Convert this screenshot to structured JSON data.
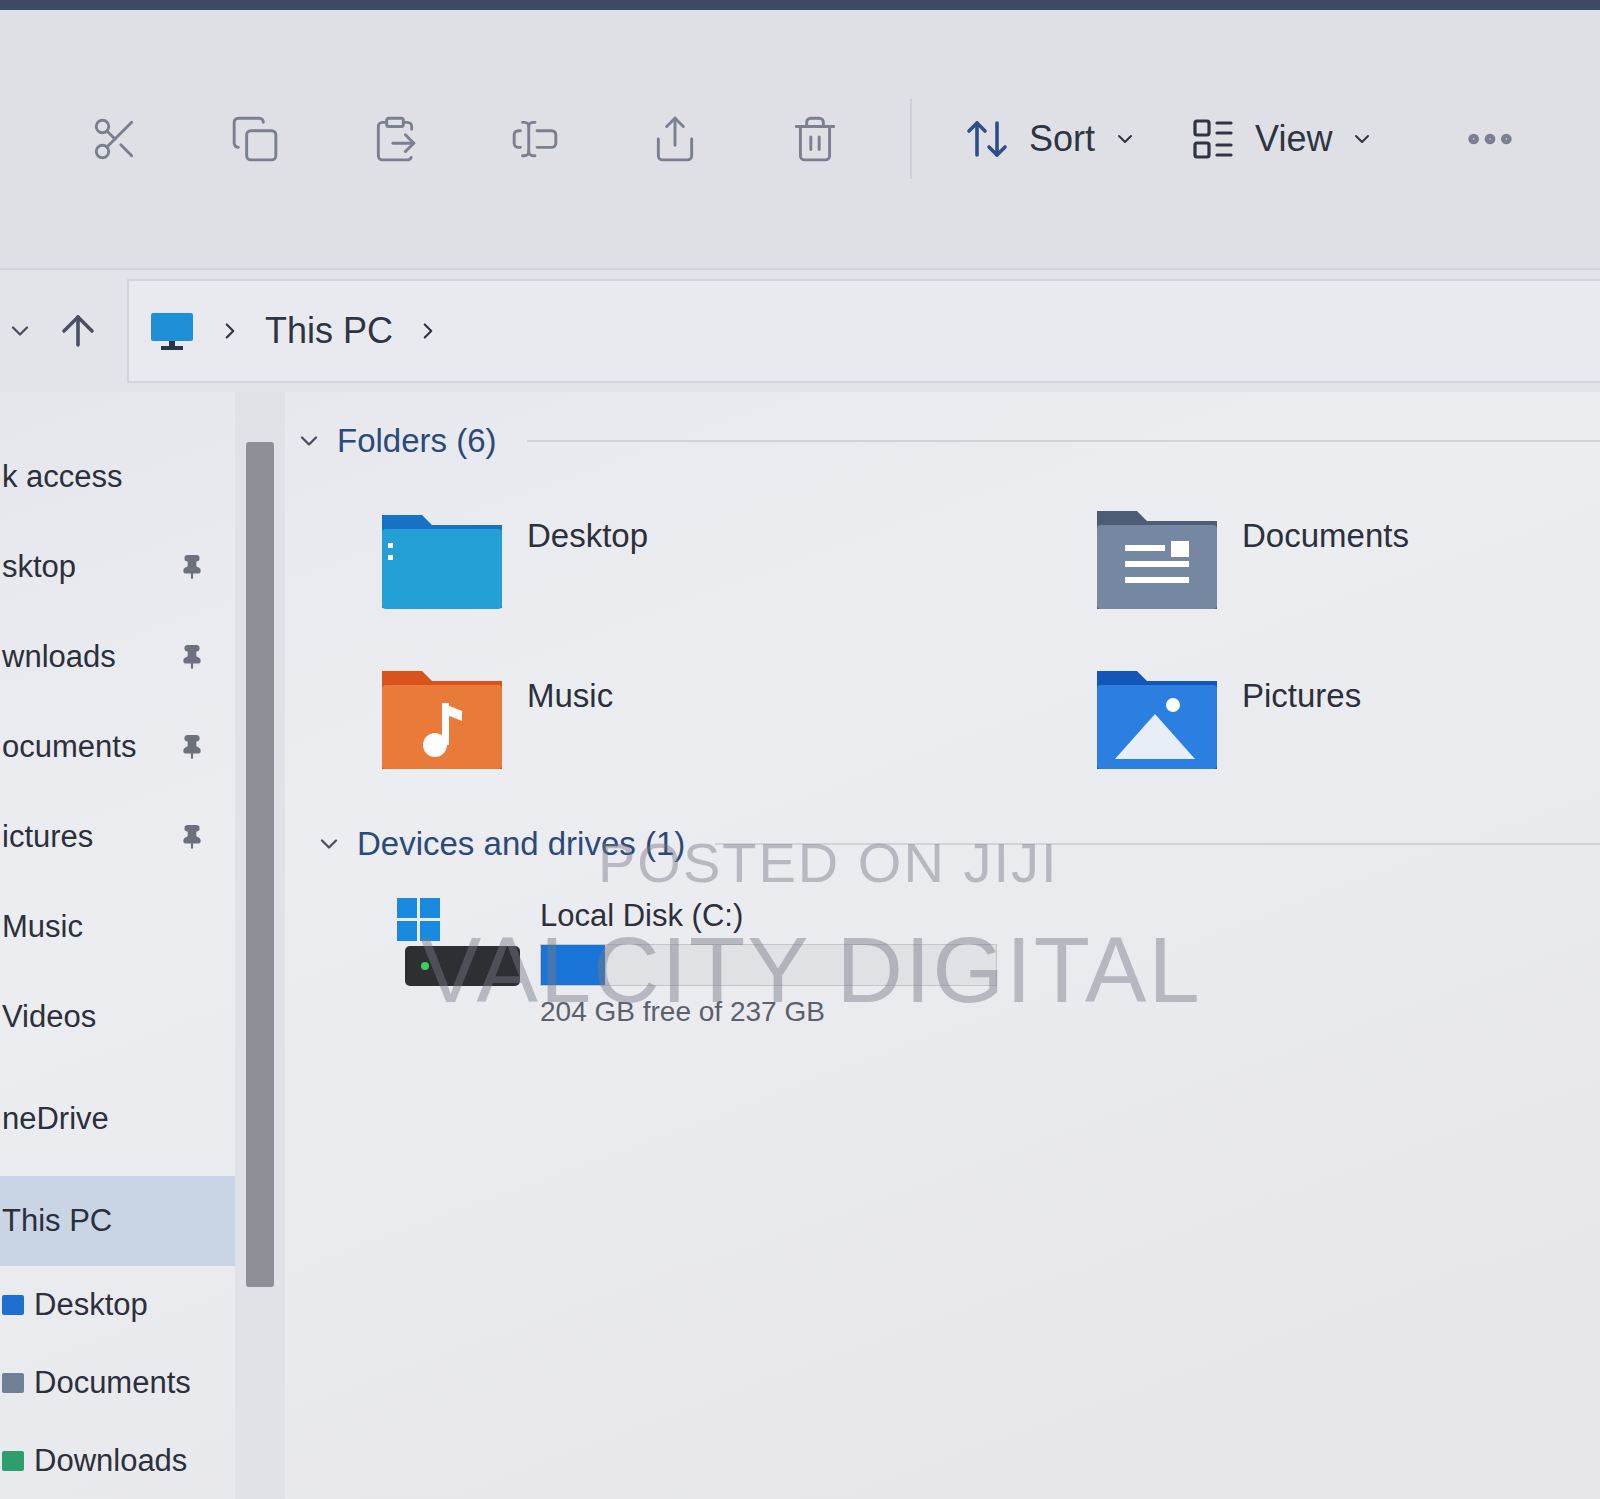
{
  "toolbar": {
    "sort": "Sort",
    "view": "View"
  },
  "breadcrumb": [
    "This PC"
  ],
  "sidebar": {
    "items": [
      {
        "label": "k access",
        "kind": "nav",
        "pinned": false,
        "selected": false
      },
      {
        "label": "sktop",
        "kind": "nav",
        "pinned": true,
        "selected": false
      },
      {
        "label": "wnloads",
        "kind": "nav",
        "pinned": true,
        "selected": false
      },
      {
        "label": "ocuments",
        "kind": "nav",
        "pinned": true,
        "selected": false
      },
      {
        "label": "ictures",
        "kind": "nav",
        "pinned": true,
        "selected": false
      },
      {
        "label": "Music",
        "kind": "nav",
        "pinned": false,
        "selected": false
      },
      {
        "label": "Videos",
        "kind": "nav",
        "pinned": false,
        "selected": false
      },
      {
        "label": "neDrive",
        "kind": "nav",
        "pinned": false,
        "selected": false
      },
      {
        "label": "This PC",
        "kind": "nav",
        "pinned": false,
        "selected": true
      },
      {
        "label": "Desktop",
        "kind": "child",
        "pinned": false,
        "selected": false,
        "color": "#1f6fd1"
      },
      {
        "label": "Documents",
        "kind": "child",
        "pinned": false,
        "selected": false,
        "color": "#6f7f95"
      },
      {
        "label": "Downloads",
        "kind": "child",
        "pinned": false,
        "selected": false,
        "color": "#2e9e6a"
      }
    ]
  },
  "folders": {
    "title": "Folders (6)",
    "expanded": true,
    "items": [
      {
        "name": "Desktop",
        "kind": "desktop"
      },
      {
        "name": "Documents",
        "kind": "documents"
      },
      {
        "name": "Music",
        "kind": "music"
      },
      {
        "name": "Pictures",
        "kind": "pictures"
      }
    ]
  },
  "drives": {
    "title": "Devices and drives (1)",
    "expanded": true,
    "items": [
      {
        "name": "Local Disk (C:)",
        "free": "204 GB free of 237 GB",
        "level": 0.14
      }
    ]
  },
  "watermarks": [
    "POSTED ON JIJI",
    "VALCITY DIGITAL"
  ]
}
